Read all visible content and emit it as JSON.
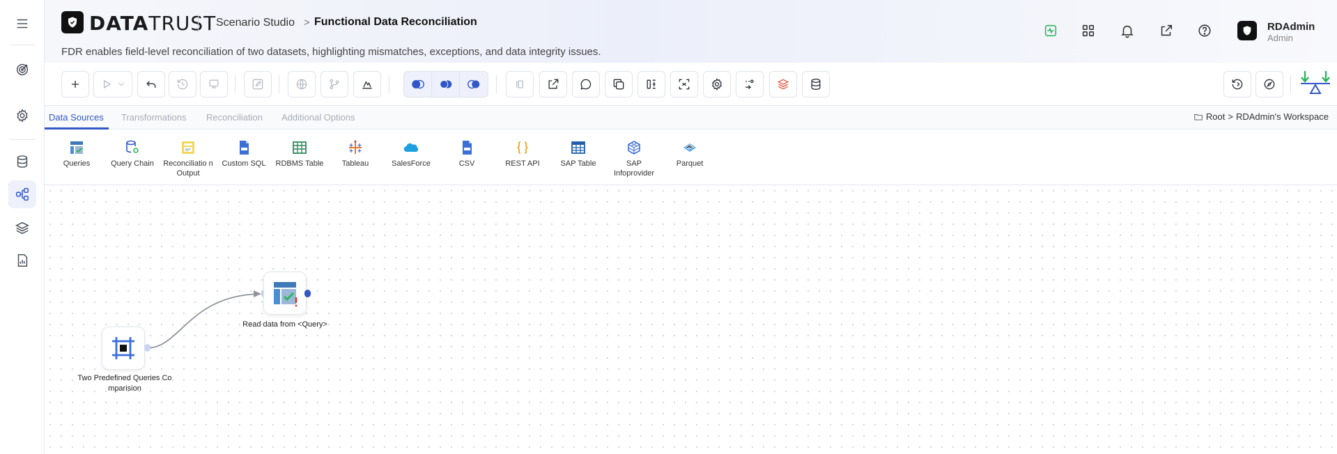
{
  "header": {
    "logo_strong": "DATA",
    "logo_light": "TRUST",
    "breadcrumb_parent": "Scenario Studio",
    "breadcrumb_sep": ">",
    "page_title": "Functional Data Reconciliation",
    "subtitle": "FDR enables field-level reconciliation of two datasets, highlighting mismatches, exceptions, and data integrity issues."
  },
  "user": {
    "name": "RDAdmin",
    "role": "Admin"
  },
  "tabs": [
    {
      "label": "Data Sources"
    },
    {
      "label": "Transformations"
    },
    {
      "label": "Reconciliation"
    },
    {
      "label": "Additional Options"
    }
  ],
  "workspace_path": {
    "root": "Root",
    "sep": ">",
    "workspace": "RDAdmin's Workspace"
  },
  "sources": [
    {
      "label": "Queries"
    },
    {
      "label": "Query Chain"
    },
    {
      "label": "Reconciliatio n Output"
    },
    {
      "label": "Custom SQL"
    },
    {
      "label": "RDBMS Table"
    },
    {
      "label": "Tableau"
    },
    {
      "label": "SalesForce"
    },
    {
      "label": "CSV"
    },
    {
      "label": "REST API"
    },
    {
      "label": "SAP Table"
    },
    {
      "label": "SAP Infoprovider"
    },
    {
      "label": "Parquet"
    }
  ],
  "nodes": {
    "source_node": {
      "label_line1": "Two Predefined Queries Co",
      "label_line2": "mparision"
    },
    "read_node": {
      "label": "Read data from <Query>"
    }
  },
  "colors": {
    "accent": "#3157c7",
    "green": "#2db55d",
    "warning": "#d93025"
  }
}
